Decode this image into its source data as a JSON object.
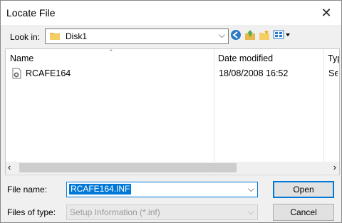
{
  "window": {
    "title": "Locate File",
    "close_glyph": "✕"
  },
  "toolbar": {
    "look_in_label": "Look in:",
    "look_in_value": "Disk1",
    "icons": [
      "back-icon",
      "up-folder-icon",
      "new-folder-icon",
      "view-menu-icon"
    ]
  },
  "file_list": {
    "columns": [
      "Name",
      "Date modified",
      "Typ"
    ],
    "rows": [
      {
        "name": "RCAFE164",
        "date": "18/08/2008 16:52",
        "type": "Setup Information"
      }
    ]
  },
  "scrollbar": {
    "left_glyph": "‹",
    "right_glyph": "›"
  },
  "form": {
    "file_name_label": "File name:",
    "file_name_value": "RCAFE164.INF",
    "file_type_label": "Files of type:",
    "file_type_value": "Setup Information (*.inf)"
  },
  "buttons": {
    "open": "Open",
    "cancel": "Cancel"
  },
  "colors": {
    "accent": "#0078d7",
    "window_bg": "#f0f0f0"
  }
}
